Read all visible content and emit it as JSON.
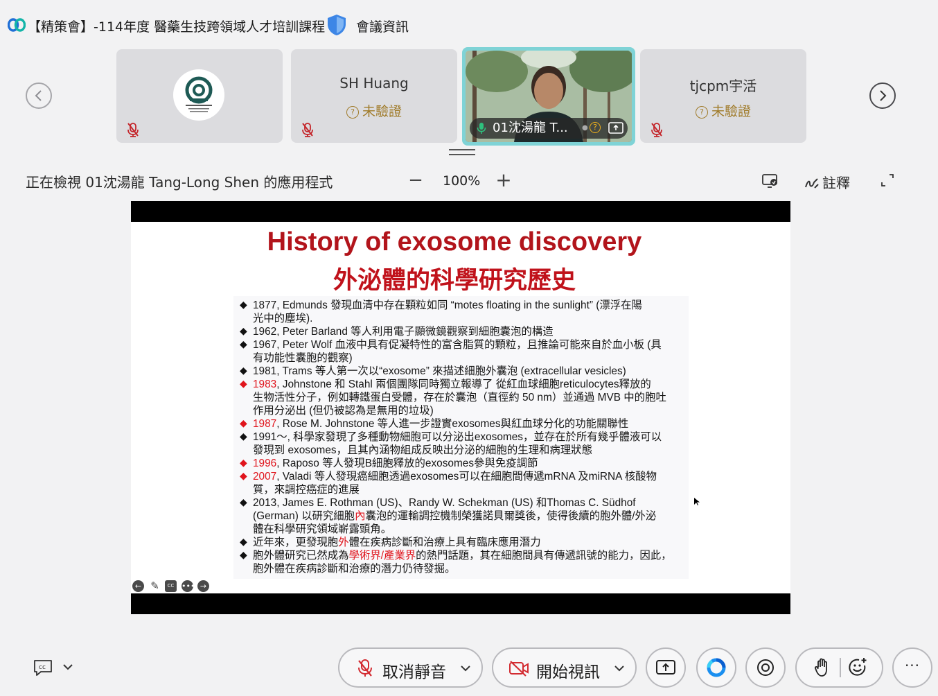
{
  "window": {
    "title": "【精策會】-114年度 醫藥生技跨領域人才培訓課程",
    "meeting_info": "會議資訊"
  },
  "participants": [
    {
      "name": "",
      "verification": ""
    },
    {
      "name": "SH Huang",
      "verification": "未驗證"
    },
    {
      "name": "01沈湯龍 T...",
      "verification": ""
    },
    {
      "name": "tjcpm宇活",
      "verification": "未驗證"
    }
  ],
  "viewing": {
    "text": "正在檢視 01沈湯龍 Tang-Long Shen 的應用程式",
    "zoom_minus": "−",
    "zoom": "100%",
    "zoom_plus": "+",
    "annotate_label": "註釋"
  },
  "slide": {
    "title_en": "History of exosome discovery",
    "title_zh": "外泌體的科學研究歷史",
    "lines": [
      "1877, Edmunds 發現血清中存在顆粒如同 “motes floating in the sunlight” (漂浮在陽",
      "光中的塵埃).",
      "1962, Peter Barland 等人利用電子顯微鏡觀察到細胞囊泡的構造",
      "1967, Peter Wolf 血液中具有促凝特性的富含脂質的顆粒，且推論可能來自於血小板 (具",
      "有功能性囊胞的觀察)",
      "1981, Trams 等人第一次以“exosome” 來描述細胞外囊泡 (extracellular vesicles)",
      "1983",
      ", Johnstone 和 Stahl 兩個團隊同時獨立報導了 從紅血球細胞reticulocytes釋放的",
      "生物活性分子，例如轉鐵蛋白受體，存在於囊泡（直徑約 50 nm）並通過 MVB 中的胞吐",
      "作用分泌出 (但仍被認為是無用的垃圾)",
      "1987",
      ", Rose M. Johnstone 等人進一步證實exosomes與紅血球分化的功能關聯性",
      "1991～, 科學家發現了多種動物細胞可以分泌出exosomes，並存在於所有幾乎體液可以",
      "發現到 exosomes，且其內涵物組成反映出分泌的細胞的生理和病理狀態",
      "1996",
      ", Raposo 等人發現B細胞釋放的exosomes參與免疫調節",
      "2007",
      ", Valadi 等人發現癌細胞透過exosomes可以在細胞間傳遞mRNA 及miRNA 核酸物",
      "質，來調控癌症的進展",
      "2013, James E. Rothman (US)、Randy W. Schekman (US) 和Thomas C. Südhof",
      "(German) 以研究細胞",
      "內",
      "囊泡的運輸調控機制榮獲諾貝爾獎後，使得後續的胞外體/外泌",
      "體在科學研究領域嶄露頭角。",
      "近年來，更發現胞",
      "外",
      "體在疾病診斷和治療上具有臨床應用潛力",
      "胞外體研究已然成為",
      "學術界/產業界",
      "的熱門話題，其在細胞間具有傳遞訊號的能力，因此，",
      "胞外體在疾病診斷和治療的潛力仍待發掘。"
    ]
  },
  "toolbar": {
    "unmute_label": "取消靜音",
    "video_label": "開始視訊",
    "more_label": "···"
  },
  "colors": {
    "accent_teal": "#7fd3d6",
    "slide_red": "#c0121b",
    "unverified": "#a07b2a"
  },
  "icons": [
    "webex-logo",
    "shield-icon",
    "chevron-left-icon",
    "chevron-right-icon",
    "mic-muted-icon",
    "minus-icon",
    "plus-icon",
    "share-view-icon",
    "annotate-icon",
    "fullscreen-icon",
    "cc-icon",
    "chevron-down-icon",
    "video-off-icon",
    "share-icon",
    "ai-assistant-icon",
    "record-icon",
    "raise-hand-icon",
    "reaction-icon",
    "more-icon"
  ]
}
